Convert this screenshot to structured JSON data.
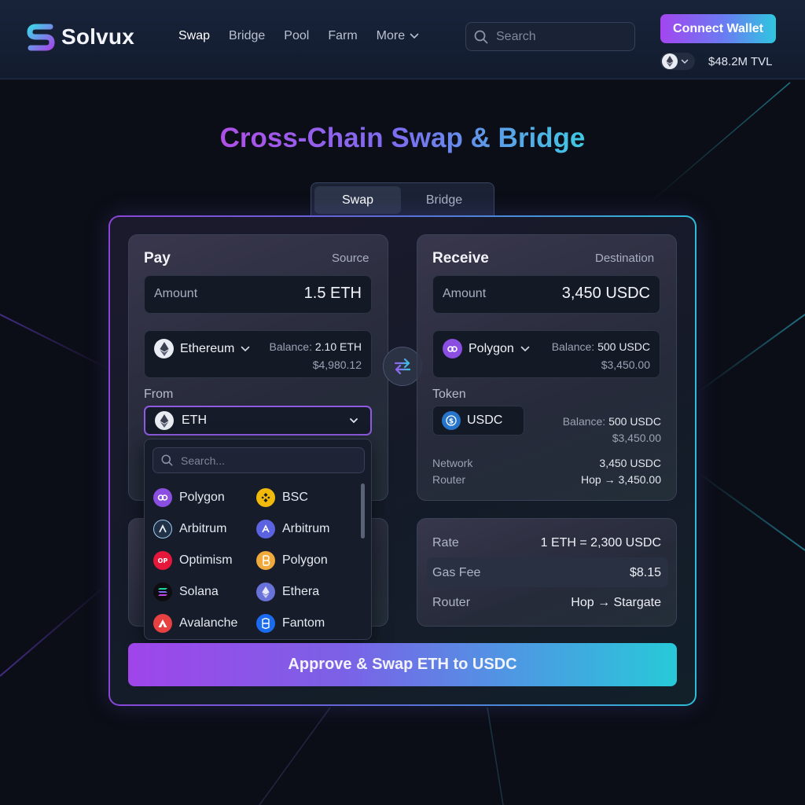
{
  "brand": {
    "name": "Solvux"
  },
  "nav": {
    "items": [
      {
        "label": "Swap",
        "active": true
      },
      {
        "label": "Bridge",
        "active": false
      },
      {
        "label": "Pool",
        "active": false
      },
      {
        "label": "Farm",
        "active": false
      },
      {
        "label": "More",
        "active": false
      }
    ]
  },
  "search": {
    "placeholder": "Search"
  },
  "wallet": {
    "connect_label": "Connect Wallet",
    "tvl": "$48.2M TVL"
  },
  "page": {
    "title": "Cross-Chain Swap & Bridge"
  },
  "tabs": [
    {
      "label": "Swap",
      "active": true
    },
    {
      "label": "Bridge",
      "active": false
    }
  ],
  "pay": {
    "title": "Pay",
    "subtitle": "Source",
    "amount_label": "Amount",
    "amount_value": "1.5 ETH",
    "chain": "Ethereum",
    "balance_label": "Balance:",
    "balance_value": "2.10 ETH",
    "balance_usd": "$4,980.12",
    "from_label": "From",
    "from_token": "ETH"
  },
  "dropdown": {
    "search_placeholder": "Search...",
    "items": [
      {
        "label": "Polygon",
        "icon": "polygon-icon"
      },
      {
        "label": "BSC",
        "icon": "bsc-icon"
      },
      {
        "label": "Arbitrum",
        "icon": "arbitrum-icon"
      },
      {
        "label": "Arbitrum",
        "icon": "arbitrum-alt-icon"
      },
      {
        "label": "Optimism",
        "icon": "optimism-icon"
      },
      {
        "label": "Polygon",
        "icon": "polygon-gold-icon"
      },
      {
        "label": "Solana",
        "icon": "solana-icon"
      },
      {
        "label": "Ethera",
        "icon": "ethereum-icon"
      },
      {
        "label": "Avalanche",
        "icon": "avalanche-icon"
      },
      {
        "label": "Fantom",
        "icon": "fantom-icon"
      }
    ]
  },
  "receive": {
    "title": "Receive",
    "subtitle": "Destination",
    "amount_label": "Amount",
    "amount_value": "3,450 USDC",
    "chain": "Polygon",
    "balance_label": "Balance:",
    "balance_value": "500 USDC",
    "balance_usd": "$3,450.00",
    "token_label": "Token",
    "token": "USDC",
    "token_balance_label": "Balance:",
    "token_balance_value": "500 USDC",
    "token_balance_usd": "$3,450.00",
    "network_label": "Network",
    "network_value": "3,450 USDC",
    "router_label": "Router",
    "router_value": "Hop → 3,450.00"
  },
  "details": {
    "rate_label": "Rate",
    "rate_value": "1 ETH = 2,300 USDC",
    "gas_label": "Gas Fee",
    "gas_value": "$8.15",
    "router_label": "Router",
    "router_value": "Hop → Stargate"
  },
  "action": {
    "label": "Approve & Swap ETH to USDC"
  },
  "colors": {
    "accent_purple": "#a346f0",
    "accent_cyan": "#2fc6e0",
    "background": "#0b0e16",
    "header": "#151e31"
  }
}
